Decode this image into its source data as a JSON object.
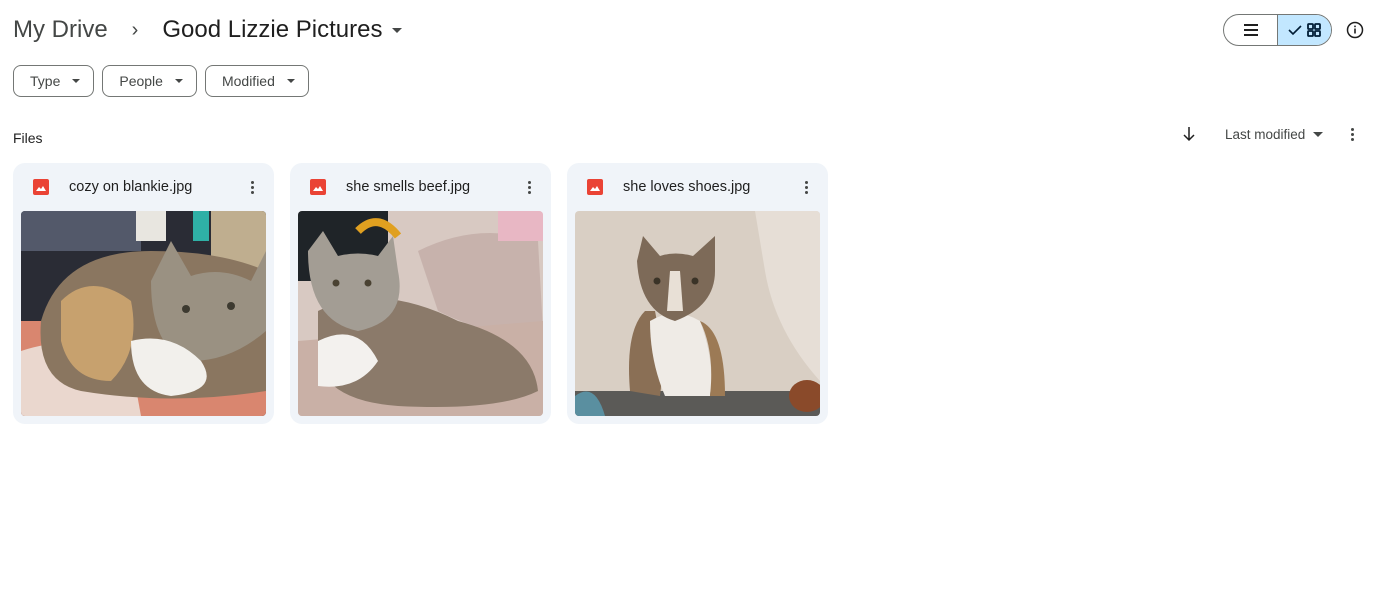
{
  "breadcrumb": {
    "root": "My Drive",
    "separator": "›",
    "current": "Good Lizzie Pictures"
  },
  "view": {
    "list_icon": "list-icon",
    "grid_icon": "grid-icon",
    "selected": "grid",
    "accent": "#c2e7ff"
  },
  "filters": [
    {
      "label": "Type"
    },
    {
      "label": "People"
    },
    {
      "label": "Modified"
    }
  ],
  "section": {
    "label": "Files"
  },
  "sort": {
    "direction": "descending",
    "label": "Last modified"
  },
  "files": [
    {
      "name": "cozy on blankie.jpg",
      "type": "image",
      "icon_color": "#ea4335"
    },
    {
      "name": "she smells beef.jpg",
      "type": "image",
      "icon_color": "#ea4335"
    },
    {
      "name": "she loves shoes.jpg",
      "type": "image",
      "icon_color": "#ea4335"
    }
  ]
}
